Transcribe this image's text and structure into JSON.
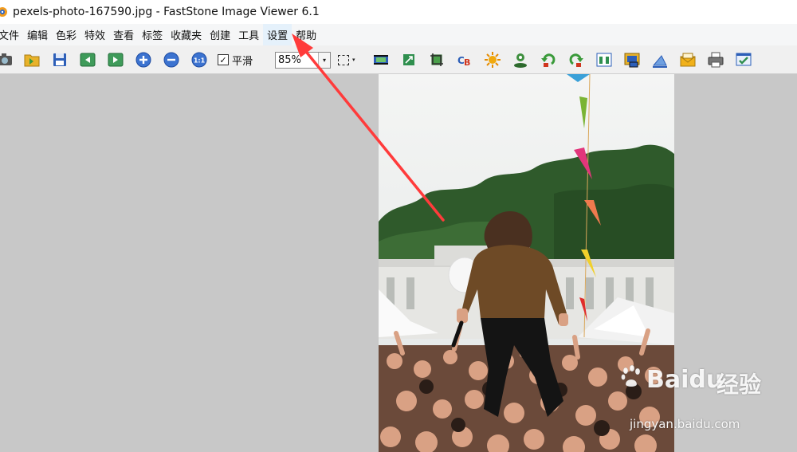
{
  "window": {
    "title": "pexels-photo-167590.jpg  -  FastStone Image Viewer 6.1"
  },
  "menu": {
    "items": [
      "文件",
      "编辑",
      "色彩",
      "特效",
      "查看",
      "标签",
      "收藏夹",
      "创建",
      "工具",
      "设置",
      "帮助"
    ],
    "highlighted": "设置",
    "first_item_visible_text": "文件"
  },
  "toolbar": {
    "smooth_label": "平滑",
    "smooth_checked": true,
    "check_glyph": "✓",
    "zoom_value": "85%",
    "zoom_arrow": "▾",
    "select_caret": "▾",
    "icons": [
      "camera-icon",
      "open-folder-icon",
      "save-icon",
      "previous-icon",
      "next-icon",
      "zoom-in-icon",
      "zoom-out-icon",
      "actual-size-icon",
      "select-rect-icon",
      "slideshow-icon",
      "resize-icon",
      "crop-icon",
      "color-balance-icon",
      "brightness-icon",
      "red-eye-icon",
      "rotate-left-icon",
      "rotate-right-icon",
      "compare-icon",
      "frame-icon",
      "draw-icon",
      "email-icon",
      "print-icon",
      "settings-icon"
    ]
  },
  "photo": {
    "filename": "pexels-photo-167590.jpg",
    "zoom_percent": 85
  },
  "watermark": {
    "brand": "Baidu",
    "brand_cn": "经验",
    "url": "jingyan.baidu.com"
  },
  "colors": {
    "arrow": "#ff3b3b",
    "background": "#c8c8c8",
    "menubar": "#f5f6f7",
    "toolbar": "#f0f0f0"
  }
}
